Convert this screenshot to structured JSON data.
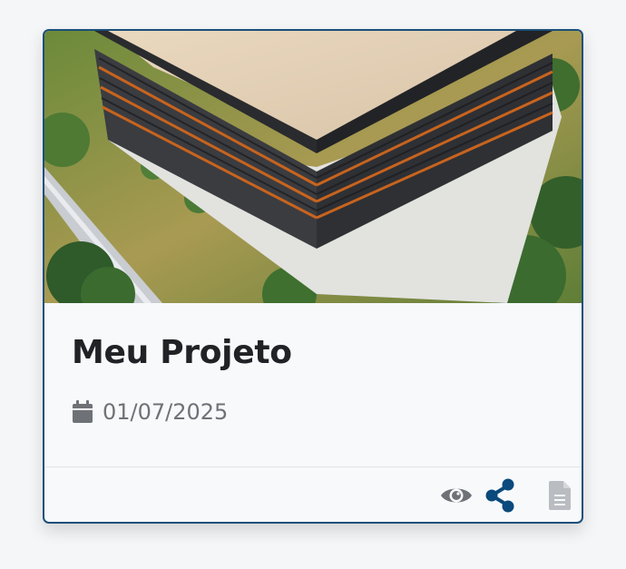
{
  "project": {
    "title": "Meu Projeto",
    "date": "01/07/2025"
  },
  "image": {
    "subject": "aerial-building-photo"
  },
  "icons": {
    "calendar": "calendar-icon",
    "view": "eye-icon",
    "share": "share-icon",
    "document": "document-icon"
  },
  "colors": {
    "card_border": "#1b4f7a",
    "share_icon": "#0b4a7c",
    "muted_icon": "#6e7277",
    "doc_icon": "#b9bcc0",
    "title_text": "#202226"
  }
}
